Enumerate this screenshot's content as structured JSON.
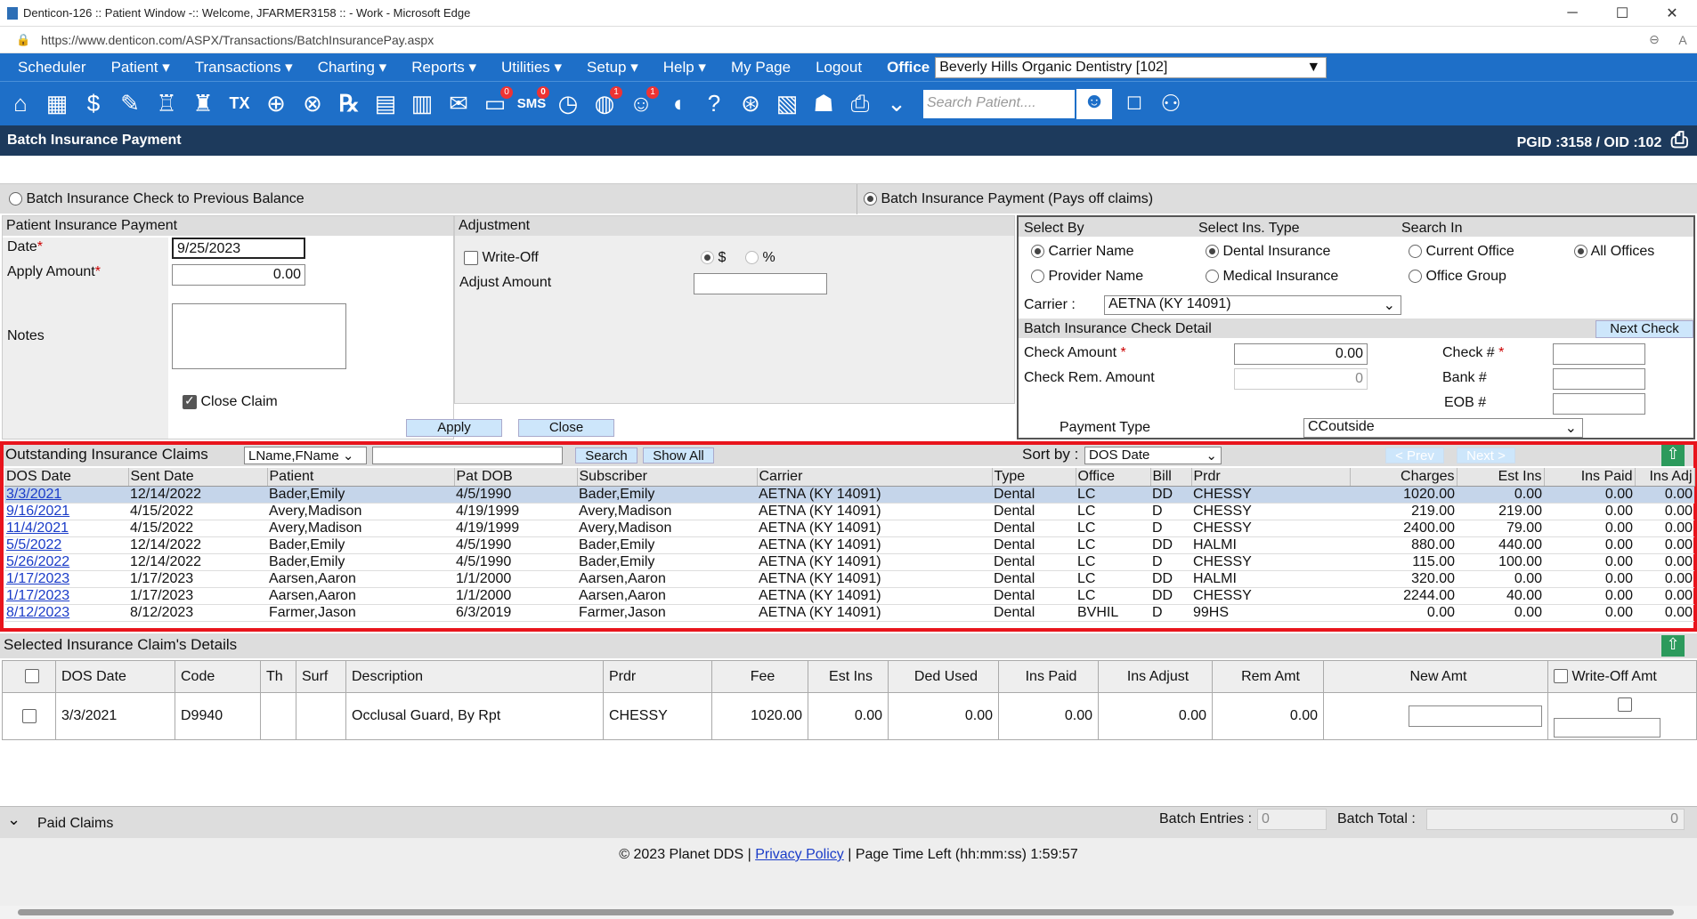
{
  "window": {
    "title": "Denticon-126 :: Patient Window -:: Welcome, JFARMER3158 :: - Work - Microsoft Edge",
    "url": "https://www.denticon.com/ASPX/Transactions/BatchInsurancePay.aspx"
  },
  "menu": {
    "items": [
      "Scheduler",
      "Patient ▾",
      "Transactions ▾",
      "Charting ▾",
      "Reports ▾",
      "Utilities ▾",
      "Setup ▾",
      "Help ▾",
      "My Page",
      "Logout"
    ],
    "office_label": "Office",
    "office_value": "Beverly Hills Organic Dentistry [102]"
  },
  "toolbar": {
    "icons": [
      "home-icon",
      "calendar-icon",
      "dollar-icon",
      "pen-list-icon",
      "tooth-chart-icon",
      "tooth-icon",
      "tx-icon",
      "add-patient-icon",
      "add-family-icon",
      "rx-icon",
      "notes-icon",
      "print-doc-icon",
      "mail-icon",
      "chat-icon",
      "sms-icon",
      "clock-icon",
      "globe-icon",
      "support-icon",
      "tooth-outline-icon",
      "help-doc-icon",
      "web-icon",
      "report-icon",
      "people-icon",
      "printer-icon",
      "dropdown-icon"
    ],
    "chat_badge": "0",
    "sms_badge": "0",
    "globe_badge": "1",
    "support_badge": "1",
    "search_placeholder": "Search Patient...."
  },
  "page": {
    "title": "Batch Insurance Payment",
    "ids": "PGID :3158  /  OID :102"
  },
  "mode": {
    "option1": "Batch Insurance Check to Previous Balance",
    "option2": "Batch Insurance Payment (Pays off claims)"
  },
  "patient_payment": {
    "header": "Patient Insurance Payment",
    "date_label": "Date",
    "date_value": "9/25/2023",
    "amount_label": "Apply Amount",
    "amount_value": "0.00",
    "notes_label": "Notes",
    "close_claim_label": "Close Claim",
    "apply_label": "Apply",
    "close_label": "Close"
  },
  "adjustment": {
    "header": "Adjustment",
    "writeoff_label": "Write-Off",
    "dollar": "$",
    "percent": "%",
    "adjust_amount_label": "Adjust Amount"
  },
  "select": {
    "select_by": "Select By",
    "ins_type": "Select Ins. Type",
    "search_in": "Search In",
    "carrier_name": "Carrier Name",
    "provider_name": "Provider Name",
    "dental": "Dental Insurance",
    "medical": "Medical Insurance",
    "current_office": "Current Office",
    "office_group": "Office Group",
    "all_offices": "All Offices",
    "carrier_label": "Carrier :",
    "carrier_value": "AETNA (KY 14091)"
  },
  "check_detail": {
    "header": "Batch Insurance Check Detail",
    "next_check": "Next Check",
    "check_amount_label": "Check Amount",
    "check_amount_value": "0.00",
    "check_rem_label": "Check Rem. Amount",
    "check_rem_value": "0",
    "check_no_label": "Check #",
    "bank_label": "Bank #",
    "eob_label": "EOB #",
    "payment_type_label": "Payment Type",
    "payment_type_value": "CCoutside"
  },
  "claims": {
    "header": "Outstanding Insurance Claims",
    "name_format": "LName,FName",
    "search_label": "Search",
    "showall_label": "Show All",
    "sortby_label": "Sort by :",
    "sortby_value": "DOS Date",
    "prev_label": "< Prev",
    "next_label": "Next >",
    "columns": [
      "DOS Date",
      "Sent Date",
      "Patient",
      "Pat DOB",
      "Subscriber",
      "Carrier",
      "Type",
      "Office",
      "Bill",
      "Prdr",
      "Charges",
      "Est Ins",
      "Ins Paid",
      "Ins Adj"
    ],
    "rows": [
      [
        "3/3/2021",
        "12/14/2022",
        "Bader,Emily",
        "4/5/1990",
        "Bader,Emily",
        "AETNA (KY 14091)",
        "Dental",
        "LC",
        "DD",
        "CHESSY",
        "1020.00",
        "0.00",
        "0.00",
        "0.00"
      ],
      [
        "9/16/2021",
        "4/15/2022",
        "Avery,Madison",
        "4/19/1999",
        "Avery,Madison",
        "AETNA (KY 14091)",
        "Dental",
        "LC",
        "D",
        "CHESSY",
        "219.00",
        "219.00",
        "0.00",
        "0.00"
      ],
      [
        "11/4/2021",
        "4/15/2022",
        "Avery,Madison",
        "4/19/1999",
        "Avery,Madison",
        "AETNA (KY 14091)",
        "Dental",
        "LC",
        "D",
        "CHESSY",
        "2400.00",
        "79.00",
        "0.00",
        "0.00"
      ],
      [
        "5/5/2022",
        "12/14/2022",
        "Bader,Emily",
        "4/5/1990",
        "Bader,Emily",
        "AETNA (KY 14091)",
        "Dental",
        "LC",
        "DD",
        "HALMI",
        "880.00",
        "440.00",
        "0.00",
        "0.00"
      ],
      [
        "5/26/2022",
        "12/14/2022",
        "Bader,Emily",
        "4/5/1990",
        "Bader,Emily",
        "AETNA (KY 14091)",
        "Dental",
        "LC",
        "D",
        "CHESSY",
        "115.00",
        "100.00",
        "0.00",
        "0.00"
      ],
      [
        "1/17/2023",
        "1/17/2023",
        "Aarsen,Aaron",
        "1/1/2000",
        "Aarsen,Aaron",
        "AETNA (KY 14091)",
        "Dental",
        "LC",
        "DD",
        "HALMI",
        "320.00",
        "0.00",
        "0.00",
        "0.00"
      ],
      [
        "1/17/2023",
        "1/17/2023",
        "Aarsen,Aaron",
        "1/1/2000",
        "Aarsen,Aaron",
        "AETNA (KY 14091)",
        "Dental",
        "LC",
        "DD",
        "CHESSY",
        "2244.00",
        "40.00",
        "0.00",
        "0.00"
      ],
      [
        "8/12/2023",
        "8/12/2023",
        "Farmer,Jason",
        "6/3/2019",
        "Farmer,Jason",
        "AETNA (KY 14091)",
        "Dental",
        "BVHIL",
        "D",
        "99HS",
        "0.00",
        "0.00",
        "0.00",
        "0.00"
      ]
    ]
  },
  "details": {
    "header": "Selected Insurance Claim's Details",
    "columns": [
      "DOS Date",
      "Code",
      "Th",
      "Surf",
      "Description",
      "Prdr",
      "Fee",
      "Est Ins",
      "Ded Used",
      "Ins Paid",
      "Ins Adjust",
      "Rem Amt",
      "New Amt",
      "Write-Off Amt"
    ],
    "row": [
      "3/3/2021",
      "D9940",
      "",
      "",
      "Occlusal Guard, By Rpt",
      "CHESSY",
      "1020.00",
      "0.00",
      "0.00",
      "0.00",
      "0.00",
      "0.00"
    ]
  },
  "paid": {
    "label": "Paid Claims",
    "batch_entries_label": "Batch Entries :",
    "batch_entries_value": "0",
    "batch_total_label": "Batch Total :",
    "batch_total_value": "0"
  },
  "footer": {
    "copyright": "© 2023 Planet DDS |",
    "privacy": "Privacy Policy",
    "sep": "|",
    "time_left": "Page Time Left (hh:mm:ss) 1:59:57"
  }
}
